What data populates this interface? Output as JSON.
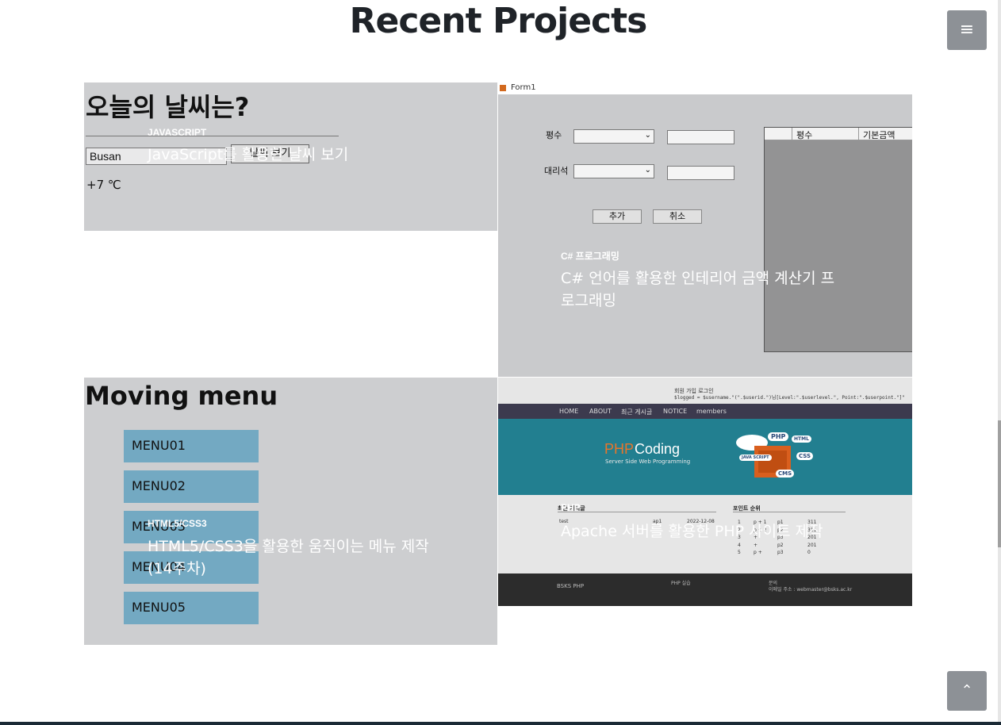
{
  "page": {
    "title": "Recent Projects"
  },
  "header": {
    "menu_icon": "hamburger-icon",
    "menu_glyph": "≡"
  },
  "footer": {
    "top_icon": "chevron-up-icon",
    "top_glyph": "⌃"
  },
  "projects": [
    {
      "category": "JAVASCRIPT",
      "description": "JavaScript를 활용한 날씨 보기"
    },
    {
      "category": "C# 프로그래밍",
      "description": "C# 언어를 활용한 인테리어 금액 계산기 프로그래밍"
    },
    {
      "category": "HTML5/CSS3",
      "description": "HTML5/CSS3을 활용한 움직이는 메뉴 제작 (14주차)"
    },
    {
      "category": "PHP",
      "description": "Apache 서버를 활용한 PHP 사이트 제작"
    }
  ],
  "weather": {
    "heading": "오늘의 날씨는?",
    "city_value": "Busan",
    "button_label": "날씨 보기",
    "temperature": "+7 ℃"
  },
  "moving_menu": {
    "heading": "Moving menu",
    "items": [
      "MENU01",
      "MENU02",
      "MENU03",
      "MENU04",
      "MENU05"
    ]
  },
  "form1": {
    "window_title": "Form1",
    "label_pyeongsu": "평수",
    "label_agency": "대리석",
    "add_button": "추가",
    "cancel_button": "취소",
    "grid_headers": [
      "평수",
      "기본금액"
    ]
  },
  "php_site": {
    "top_text": "회원 가입 로그인",
    "code_text": "$logged = $username.\"(\".$userid.\")님[Level:\".$userlevel.\", Point:\".$userpoint.\"]\"",
    "nav": [
      "HOME",
      "ABOUT",
      "최근 게시글",
      "NOTICE",
      "members"
    ],
    "banner_title_accent": "PHP",
    "banner_title": "Coding",
    "banner_sub": "Server Side Web Programming",
    "badges": [
      "PHP",
      "HTML",
      "JAVA SCRIPT",
      "CSS",
      "CMS"
    ],
    "section_left": "최근 게시글",
    "section_right": "포인트 순위",
    "post_row": [
      "test",
      "ap1",
      "2022-12-08"
    ],
    "ranks": [
      [
        "1",
        "p + 1",
        "p1",
        "311"
      ],
      [
        "2",
        "p + 2",
        "p2",
        "311"
      ],
      [
        "3",
        "+",
        "p3",
        "201"
      ],
      [
        "4",
        "+",
        "p2",
        "201"
      ],
      [
        "5",
        "p +",
        "p3",
        "0"
      ]
    ],
    "footer_left": "BSKS PHP",
    "footer_mid": "PHP 실습",
    "footer_right_1": "문의",
    "footer_right_2": "이메일 주소 : webmaster@bsks.ac.kr"
  }
}
